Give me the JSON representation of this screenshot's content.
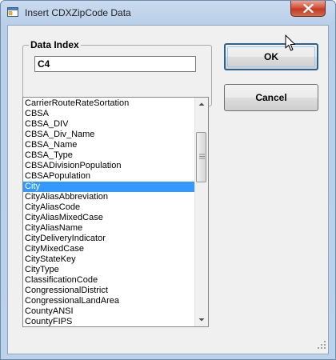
{
  "window": {
    "title": "Insert CDXZipCode Data"
  },
  "data_index": {
    "legend": "Data Index",
    "value": "C4"
  },
  "buttons": {
    "ok_label": "OK",
    "cancel_label": "Cancel"
  },
  "field_list": {
    "selected": "City",
    "items": [
      "CarrierRouteRateSortation",
      "CBSA",
      "CBSA_DIV",
      "CBSA_Div_Name",
      "CBSA_Name",
      "CBSA_Type",
      "CBSADivisionPopulation",
      "CBSAPopulation",
      "City",
      "CityAliasAbbreviation",
      "CityAliasCode",
      "CityAliasMixedCase",
      "CityAliasName",
      "CityDeliveryIndicator",
      "CityMixedCase",
      "CityStateKey",
      "CityType",
      "ClassificationCode",
      "CongressionalDistrict",
      "CongressionalLandArea",
      "CountyANSI",
      "CountyFIPS"
    ]
  },
  "icons": {
    "app": "app-window-icon",
    "close": "close-x-icon",
    "scroll_up": "triangle-up-icon",
    "scroll_down": "triangle-down-icon",
    "cursor": "mouse-pointer-icon"
  },
  "colors": {
    "selection": "#3399ff",
    "close_button": "#c23a22",
    "default_button_border": "#2c628b"
  }
}
